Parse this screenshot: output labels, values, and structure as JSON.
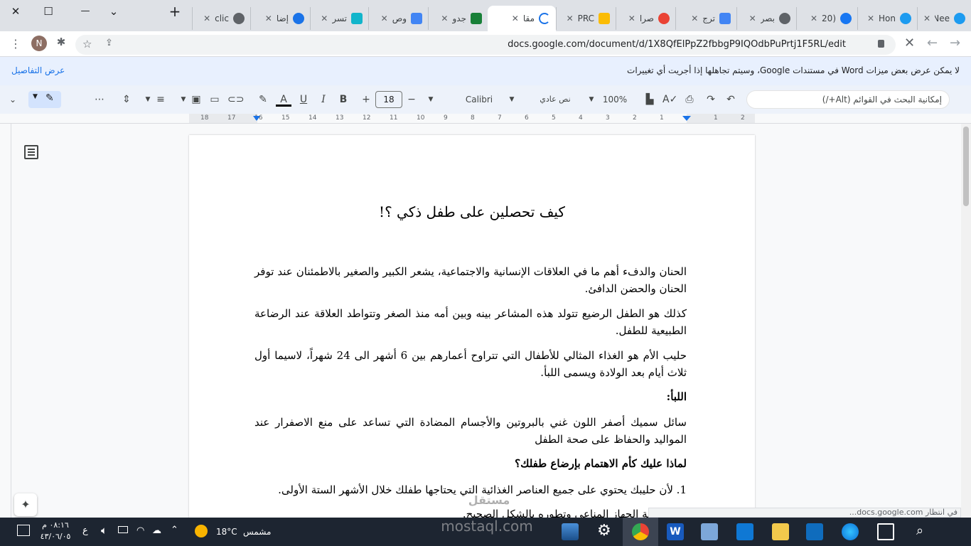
{
  "tabs": [
    {
      "label": "Nee",
      "icon": "twitter-blue-icon",
      "color": "#1d9bf0"
    },
    {
      "label": "Hon",
      "icon": "twitter-icon",
      "color": "#1d9bf0"
    },
    {
      "label": "(20",
      "icon": "facebook-icon",
      "color": "#1877f2"
    },
    {
      "label": "بصر",
      "icon": "globe-icon",
      "color": "#5f6368"
    },
    {
      "label": "ترج",
      "icon": "google-translate-icon",
      "color": "#4285f4"
    },
    {
      "label": "صرا",
      "icon": "google-icon",
      "color": "#ea4335"
    },
    {
      "label": "PRC",
      "icon": "google-drive-icon",
      "color": "#fbbc04"
    },
    {
      "label": "مقا",
      "icon": "loading-icon",
      "color": "#1a73e8",
      "active": true
    },
    {
      "label": "جدو",
      "icon": "sheets-icon",
      "color": "#188038"
    },
    {
      "label": "وص",
      "icon": "docs-icon",
      "color": "#4285f4"
    },
    {
      "label": "تسر",
      "icon": "droplet-icon",
      "color": "#12b5cb"
    },
    {
      "label": "إضا",
      "icon": "circle-icon",
      "color": "#1a73e8"
    },
    {
      "label": "clic",
      "icon": "globe-icon",
      "color": "#5f6368"
    }
  ],
  "window": {
    "minimize": "—",
    "maximize": "☐",
    "close": "✕",
    "chevron": "⌄",
    "new_tab": "+"
  },
  "address": {
    "url": "docs.google.com/document/d/1X8QfElPpZ2fbbgP9IQOdbPuPrtj1F5RL/edit",
    "profile": "N"
  },
  "banner": {
    "message": "لا يمكن عرض بعض ميزات Word في مستندات Google، وسيتم تجاهلها إذا أجريت أي تغييرات",
    "details_link": "عرض التفاصيل"
  },
  "toolbar": {
    "search_placeholder": "إمكانية البحث في القوائم (Alt+/)",
    "zoom": "100%",
    "style": "نص عادي",
    "font": "Calibri",
    "font_size": "18",
    "more": "⋯"
  },
  "ruler": {
    "numbers": [
      "18",
      "17",
      "16",
      "15",
      "14",
      "13",
      "12",
      "11",
      "10",
      "9",
      "8",
      "7",
      "6",
      "5",
      "4",
      "3",
      "2",
      "1",
      "",
      "1",
      "2"
    ]
  },
  "document": {
    "title": "كيف تحصلين على طفل ذكي ؟!",
    "paragraphs": [
      {
        "text": "الحنان والدفء أهم ما في العلاقات الإنسانية والاجتماعية، يشعر الكبير والصغير بالاطمئنان عند توفر الحنان والحضن الدافئ.",
        "bold": false
      },
      {
        "text": "كذلك هو الطفل الرضيع تتولد هذه المشاعر بينه وبين أمه منذ الصغر وتتواطد العلاقة عند الرضاعة الطبيعية للطفل.",
        "bold": false
      },
      {
        "text": "حليب الأم هو الغذاء المثالي للأطفال التي تتراوح أعمارهم بين 6 أشهر الى 24 شهراً، لاسيما أول ثلاث أيام بعد الولادة ويسمى اللبأ.",
        "bold": false
      },
      {
        "text": "اللبأ:",
        "bold": true
      },
      {
        "text": "سائل سميك أصفر اللون غني بالبروتين والأجسام المضادة التي تساعد على منع الاصفرار عند المواليد والحفاظ على صحة الطفل",
        "bold": false
      },
      {
        "text": "لماذا عليك كأم الاهتمام بإرضاع طفلك؟",
        "bold": true
      },
      {
        "text": "1. لأن حليبك يحتوي على جميع العناصر الغذائية التي يحتاجها طفلك خلال الأشهر الستة الأولى.",
        "bold": false
      },
      {
        "text": "على تقوية الجهاز المناعي وتطوره بالشكل الصحيح.",
        "bold": false
      }
    ]
  },
  "status_bar": {
    "text": "في انتظار docs.google.com..."
  },
  "watermark": {
    "arabic": "مستقل",
    "latin": "mostaql.com"
  },
  "taskbar": {
    "time": "٠٨:١٦ م",
    "date": "٤٣/٠٦/٠٥",
    "lang": "ع",
    "temp": "18°C",
    "weather": "مشمس"
  }
}
